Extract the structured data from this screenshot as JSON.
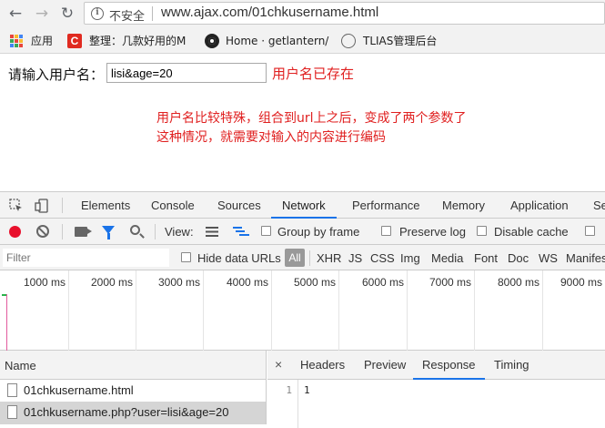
{
  "browser": {
    "back_glyph": "←",
    "forward_glyph": "→",
    "reload_glyph": "↻",
    "info_glyph": "i",
    "security_text": "不安全",
    "url": "www.ajax.com/01chkusername.html"
  },
  "bookmarks": {
    "apps_label": "应用",
    "item1_icon_text": "C",
    "item1_label": "整理：几款好用的M",
    "item2_label": "Home · getlantern/",
    "item3_label": "TLIAS管理后台",
    "apps_colors": [
      "#e8453c",
      "#f9bb2d",
      "#4285f4",
      "#3aa757",
      "#e8453c",
      "#f9bb2d",
      "#4285f4",
      "#3aa757",
      "#e8453c"
    ]
  },
  "page": {
    "label": "请输入用户名：",
    "input_value": "lisi&age=20",
    "status": "用户名已存在",
    "note_line1": "用户名比较特殊，组合到url上之后，变成了两个参数了",
    "note_line2": "这种情况，就需要对输入的内容进行编码"
  },
  "devtools": {
    "tabs": [
      "Elements",
      "Console",
      "Sources",
      "Network",
      "Performance",
      "Memory",
      "Application",
      "Se"
    ],
    "active_tab": "Network",
    "view_label": "View:",
    "group_by_frame": "Group by frame",
    "preserve_log": "Preserve log",
    "disable_cache": "Disable cache",
    "filter_placeholder": "Filter",
    "hide_data_urls": "Hide data URLs",
    "all_label": "All",
    "types": [
      "XHR",
      "JS",
      "CSS",
      "Img",
      "Media",
      "Font",
      "Doc",
      "WS",
      "Manifes"
    ],
    "ticks": [
      "1000 ms",
      "2000 ms",
      "3000 ms",
      "4000 ms",
      "5000 ms",
      "6000 ms",
      "7000 ms",
      "8000 ms",
      "9000 ms"
    ],
    "name_header": "Name",
    "requests": [
      "01chkusername.html",
      "01chkusername.php?user=lisi&age=20"
    ],
    "close_glyph": "×",
    "detail_tabs": [
      "Headers",
      "Preview",
      "Response",
      "Timing"
    ],
    "active_detail_tab": "Response",
    "line_number": "1",
    "response_body": "1"
  }
}
